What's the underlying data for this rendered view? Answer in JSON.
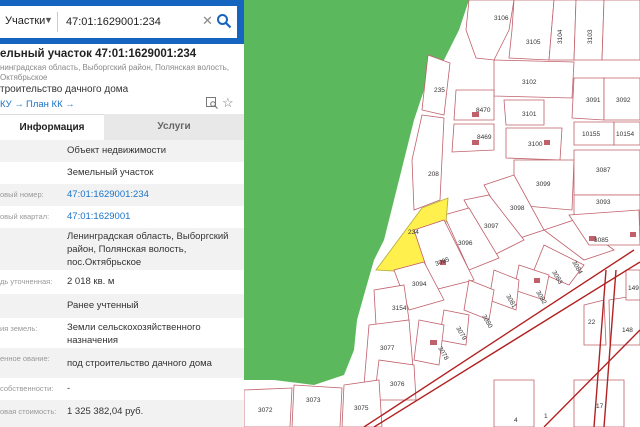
{
  "search": {
    "layer": "Участки",
    "query": "47:01:1629001:234",
    "clear_icon": "close-icon",
    "search_icon": "search-icon"
  },
  "collapse_icon": "chevron-left-icon",
  "object": {
    "title": "ельный участок 47:01:1629001:234",
    "address": "нинградская область, Выборгский район, Полянская волость, Октябрьское",
    "use": "троительство дачного дома",
    "link_kpt": "КУ →",
    "link_plan": "План КК →"
  },
  "tabs": {
    "info": "Информация",
    "services": "Услуги"
  },
  "rows": [
    {
      "label": "",
      "value": "Объект недвижимости"
    },
    {
      "label": "",
      "value": "Земельный участок"
    },
    {
      "label": "овый номер:",
      "value": "47:01:1629001:234"
    },
    {
      "label": "овый квартал:",
      "value": "47:01:1629001"
    },
    {
      "label": "",
      "value": "Ленинградская область, Выборгский район, Полянская волость, пос.Октябрьское"
    },
    {
      "label": "дь уточненная:",
      "value": "2 018 кв. м"
    },
    {
      "label": "",
      "value": "Ранее учтенный"
    },
    {
      "label": "ия земель:",
      "value": "Земли сельскохозяйственного назначения"
    },
    {
      "label": "енное ование:",
      "value": "под строительство дачного дома"
    },
    {
      "label": "собственности:",
      "value": "-"
    },
    {
      "label": "овая стоимость:",
      "value": "1 325 382,04 руб."
    }
  ],
  "map": {
    "colors": {
      "forest": "#5cb85c",
      "highlight": "#fff04d",
      "boundary": "#c0606a",
      "road": "#b22222"
    },
    "plot_labels": [
      "3106",
      "3105",
      "3104",
      "3103",
      "3102",
      "235",
      "8470",
      "3101",
      "3091",
      "3092",
      "8469",
      "3100",
      "10155",
      "10154",
      "3087",
      "208",
      "3099",
      "3098",
      "3097",
      "3096",
      "234",
      "3095",
      "3085",
      "3093",
      "3084",
      "3094",
      "3082",
      "3083",
      "3081",
      "3080",
      "3154",
      "3079",
      "3078",
      "3077",
      "22",
      "148",
      "3076",
      "3075",
      "3073",
      "3072",
      "17",
      "4",
      "1",
      "149"
    ]
  }
}
